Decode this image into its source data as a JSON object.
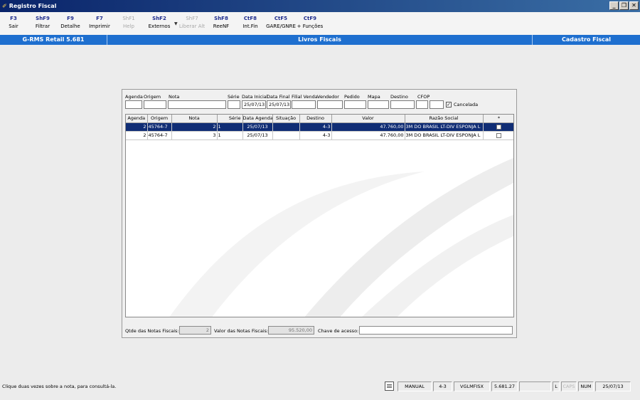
{
  "window": {
    "title": "Registro Fiscal",
    "controls": [
      "_",
      "❐",
      "✕"
    ]
  },
  "toolbar": [
    {
      "key": "F3",
      "label": "Sair",
      "enabled": true
    },
    {
      "key": "ShF9",
      "label": "Filtrar",
      "enabled": true
    },
    {
      "key": "F9",
      "label": "Detalhe",
      "enabled": true
    },
    {
      "key": "F7",
      "label": "Imprimir",
      "enabled": true
    },
    {
      "key": "ShF1",
      "label": "Help",
      "enabled": false
    },
    {
      "key": "ShF2",
      "label": "Externos",
      "enabled": true
    },
    {
      "key": "ShF7",
      "label": "Liberar Alt",
      "enabled": false
    },
    {
      "key": "ShF8",
      "label": "ReeNF",
      "enabled": true
    },
    {
      "key": "CtF8",
      "label": "Int.Fin",
      "enabled": true
    },
    {
      "key": "CtF5",
      "label": "GARE/GNRE",
      "enabled": true
    },
    {
      "key": "CtF9",
      "label": "+ Funções",
      "enabled": true
    }
  ],
  "header_bar": {
    "left": "G-RMS Retail 5.681",
    "center": "Livros Fiscais",
    "right": "Cadastro Fiscal"
  },
  "filters": {
    "labels": [
      "Agenda",
      "Origem",
      "Nota",
      "Série",
      "Data Inicial",
      "Data Final",
      "Filial Venda",
      "Vendedor",
      "Pedido",
      "Mapa",
      "Destino",
      "CFOP"
    ],
    "data_inicial": "25/07/13",
    "data_final": "25/07/13",
    "cancelada_label": "Cancelada",
    "cancelada_checked": true,
    "checkmark": "✓"
  },
  "grid": {
    "columns": [
      "Agenda",
      "Origem",
      "Nota",
      "Série",
      "Data Agenda",
      "Situação",
      "Destino",
      "Valor",
      "Razão Social",
      "*"
    ],
    "rows": [
      {
        "agenda": "2",
        "origem": "45764-7",
        "nota": "2",
        "serie": "1",
        "data_agenda": "25/07/13",
        "situacao": "",
        "destino": "4-3",
        "valor": "47.760,00",
        "razao_social": "3M DO BRASIL LT-DIV ESPONJA L",
        "selected": true
      },
      {
        "agenda": "2",
        "origem": "45764-7",
        "nota": "3",
        "serie": "1",
        "data_agenda": "25/07/13",
        "situacao": "",
        "destino": "4-3",
        "valor": "47.760,00",
        "razao_social": "3M DO BRASIL LT-DIV ESPONJA L",
        "selected": false
      }
    ]
  },
  "footer": {
    "qtde_label": "Qtde das Notas Fiscais:",
    "qtde_value": "2",
    "valor_label": "Valor  das Notas Fiscais:",
    "valor_value": "95.520,00",
    "chave_label": "Chave de acesso:",
    "chave_value": ""
  },
  "statusbar": {
    "message": "Clique duas vezes sobre a nota, para consultá-la.",
    "mode": "MANUAL",
    "branch": "4-3",
    "program": "VGLMFISX",
    "version": "5.681.27",
    "empty": "",
    "l": "L",
    "caps": "CAPS",
    "num": "NUM",
    "date": "25/07/13"
  }
}
